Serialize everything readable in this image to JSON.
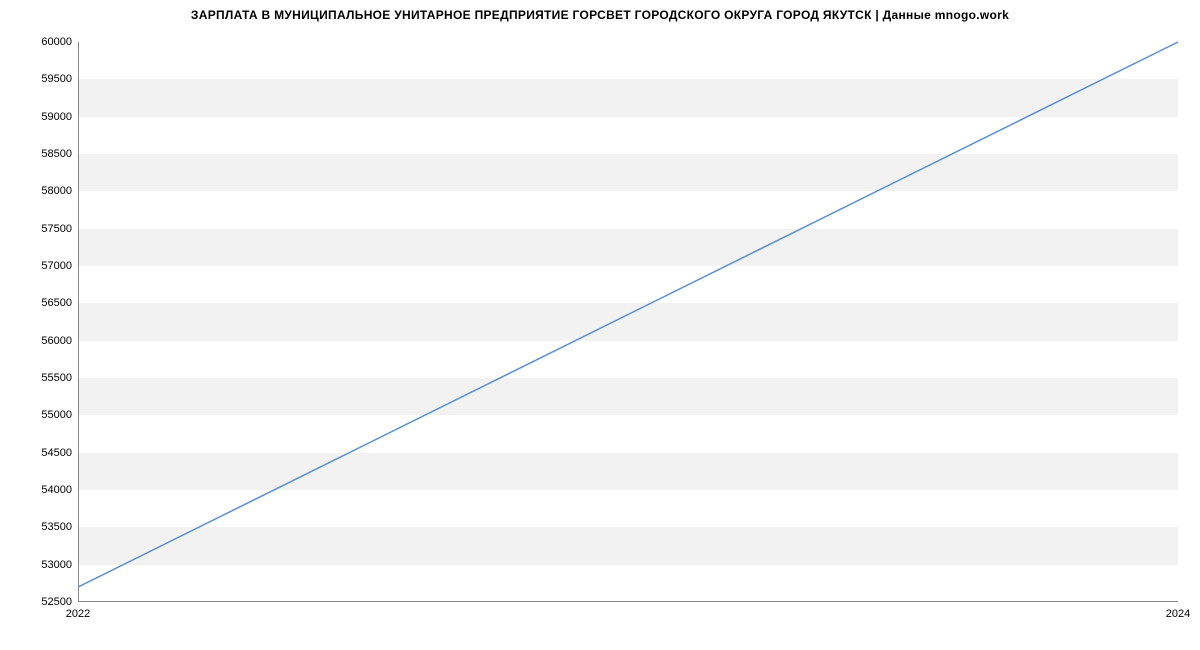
{
  "chart_data": {
    "type": "line",
    "title": "ЗАРПЛАТА В МУНИЦИПАЛЬНОЕ УНИТАРНОЕ ПРЕДПРИЯТИЕ ГОРСВЕТ ГОРОДСКОГО ОКРУГА ГОРОД ЯКУТСК | Данные mnogo.work",
    "xlabel": "",
    "ylabel": "",
    "x": [
      2022,
      2024
    ],
    "values": [
      52700,
      60000
    ],
    "xlim": [
      2022,
      2024
    ],
    "ylim": [
      52500,
      60000
    ],
    "x_ticks": [
      "2022",
      "2024"
    ],
    "y_ticks": [
      "52500",
      "53000",
      "53500",
      "54000",
      "54500",
      "55000",
      "55500",
      "56000",
      "56500",
      "57000",
      "57500",
      "58000",
      "58500",
      "59000",
      "59500",
      "60000"
    ],
    "line_color": "#5b8fd6",
    "grid": true
  }
}
